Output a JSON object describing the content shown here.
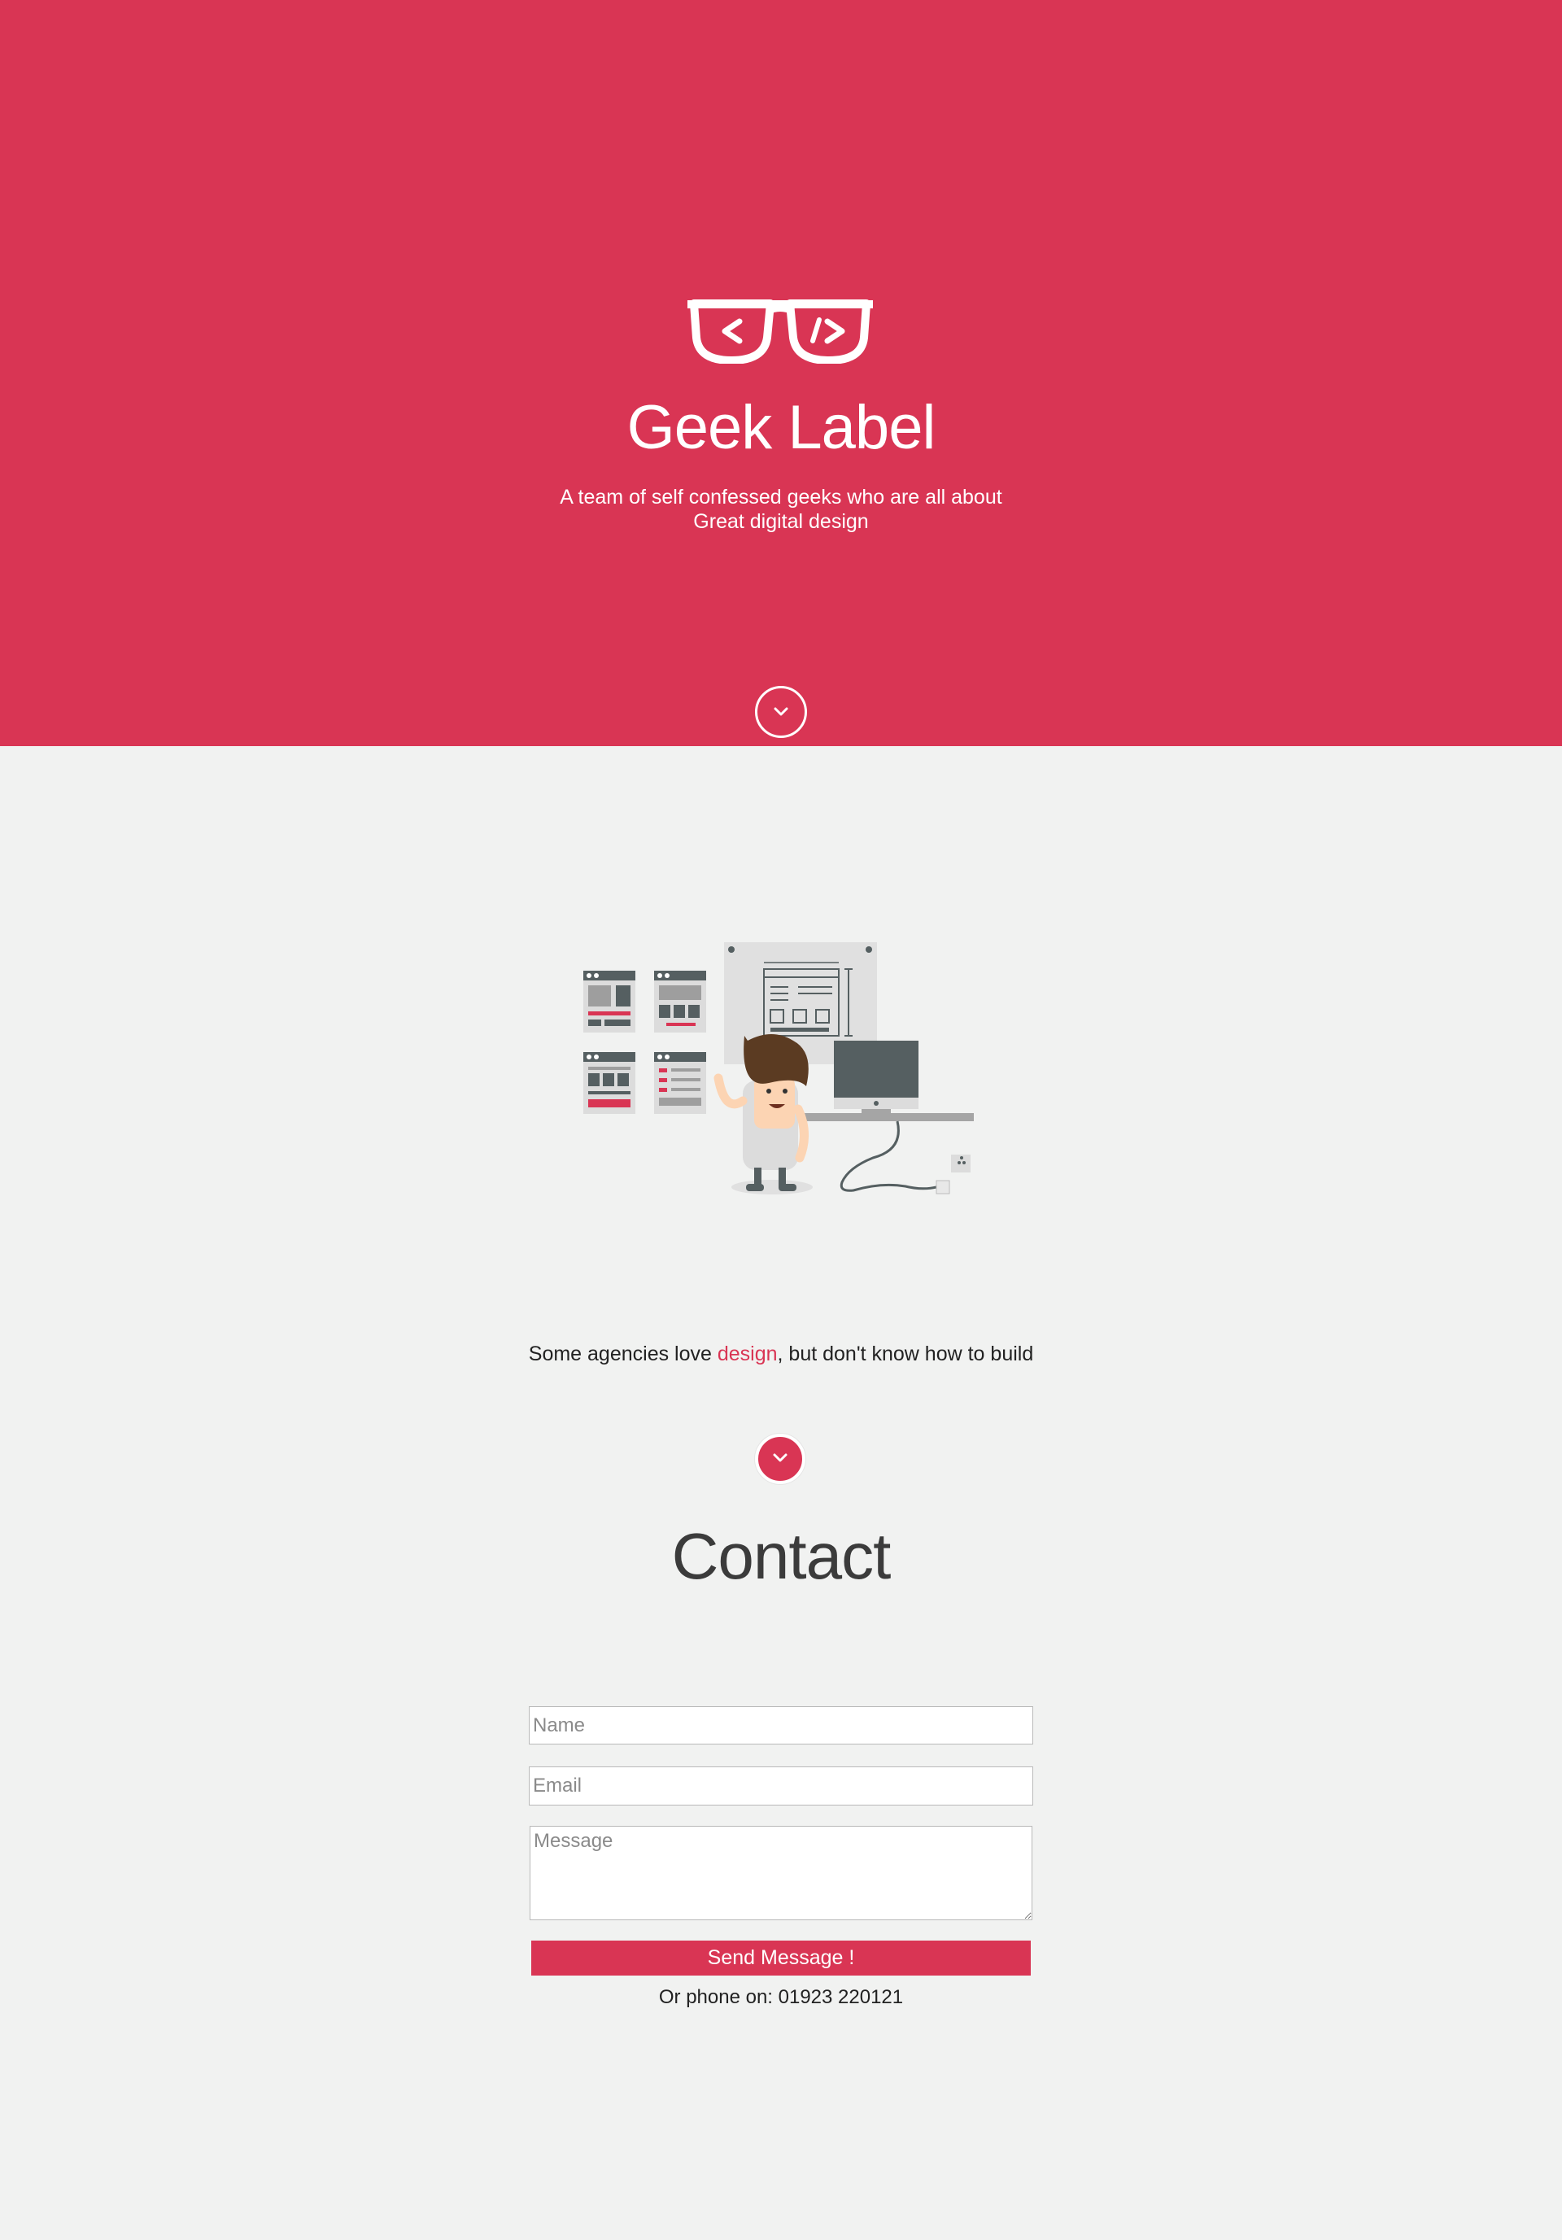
{
  "hero": {
    "brand": "Geek Label",
    "tagline_line1": "A team of self confessed geeks who are all about",
    "tagline_line2": "Great digital design",
    "logo_icon": "glasses-code-icon",
    "scroll_icon": "chevron-down-icon",
    "background_color": "#d93554"
  },
  "about": {
    "text_before": "Some agencies love ",
    "text_accent": "design",
    "text_after": ", but don't know how to build",
    "illustration": "developer-at-desk-illustration",
    "scroll_icon": "chevron-down-icon"
  },
  "contact": {
    "title": "Contact",
    "name_placeholder": "Name",
    "email_placeholder": "Email",
    "message_placeholder": "Message",
    "send_label": "Send Message !",
    "phone_label": "Or phone on: 01923 220121"
  },
  "colors": {
    "accent": "#d93554",
    "page_background": "#f1f2f1",
    "heading_text": "#3b3b3b"
  }
}
